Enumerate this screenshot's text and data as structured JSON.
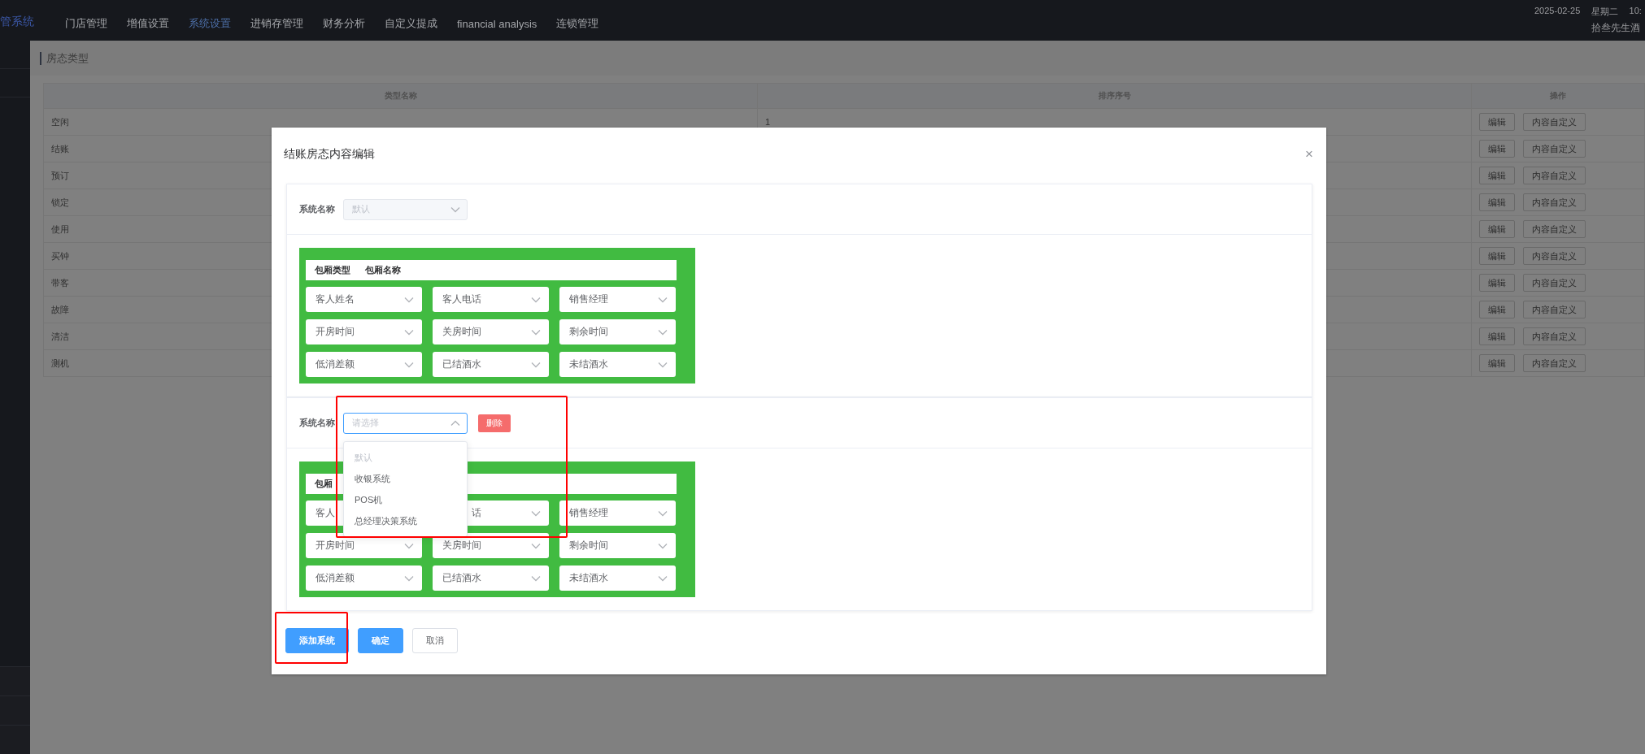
{
  "topbar": {
    "logo": "管系统",
    "nav": [
      {
        "label": "门店管理",
        "selected": false
      },
      {
        "label": "增值设置",
        "selected": false
      },
      {
        "label": "系统设置",
        "selected": true
      },
      {
        "label": "进销存管理",
        "selected": false
      },
      {
        "label": "财务分析",
        "selected": false
      },
      {
        "label": "自定义提成",
        "selected": false
      },
      {
        "label": "financial analysis",
        "selected": false
      },
      {
        "label": "连锁管理",
        "selected": false
      }
    ],
    "date": "2025-02-25",
    "weekday": "星期二",
    "time": "10:",
    "user": "拾叁先生酒"
  },
  "page": {
    "title": "房态类型"
  },
  "table": {
    "columns": [
      "类型名称",
      "排序序号",
      "操作"
    ],
    "rows": [
      {
        "name": "空闲",
        "sort": "1",
        "actions": [
          "编辑",
          "内容自定义"
        ]
      },
      {
        "name": "结账",
        "actions": [
          "编辑",
          "内容自定义"
        ]
      },
      {
        "name": "预订",
        "actions": [
          "编辑",
          "内容自定义"
        ]
      },
      {
        "name": "锁定",
        "actions": [
          "编辑",
          "内容自定义"
        ]
      },
      {
        "name": "使用",
        "actions": [
          "编辑",
          "内容自定义"
        ]
      },
      {
        "name": "买钟",
        "actions": [
          "编辑",
          "内容自定义"
        ]
      },
      {
        "name": "带客",
        "actions": [
          "编辑",
          "内容自定义"
        ]
      },
      {
        "name": "故障",
        "actions": [
          "编辑",
          "内容自定义"
        ]
      },
      {
        "name": "清洁",
        "actions": [
          "编辑",
          "内容自定义"
        ]
      },
      {
        "name": "测机",
        "actions": [
          "编辑",
          "内容自定义"
        ]
      }
    ]
  },
  "modal": {
    "title": "结账房态内容编辑",
    "close": "×",
    "sections": [
      {
        "label": "系统名称",
        "select": {
          "value": "默认",
          "disabled": true,
          "open": false
        },
        "header": [
          "包厢类型",
          "包厢名称"
        ],
        "fields": [
          {
            "kind": "select",
            "label": "客人姓名"
          },
          {
            "kind": "select",
            "label": "客人电话"
          },
          {
            "kind": "select",
            "label": "销售经理"
          },
          {
            "kind": "select",
            "label": "开房时间"
          },
          {
            "kind": "select",
            "label": "关房时间"
          },
          {
            "kind": "select",
            "label": "剩余时间"
          },
          {
            "kind": "select",
            "label": "低消差额"
          },
          {
            "kind": "select",
            "label": "已结酒水"
          },
          {
            "kind": "select",
            "label": "未结酒水"
          }
        ]
      },
      {
        "label": "系统名称",
        "select": {
          "placeholder": "请选择",
          "disabled": false,
          "open": true,
          "options": [
            {
              "label": "默认",
              "disabled": true
            },
            {
              "label": "收银系统",
              "disabled": false
            },
            {
              "label": "POS机",
              "disabled": false
            },
            {
              "label": "总经理决策系统",
              "disabled": false
            }
          ]
        },
        "delete": "删除",
        "header": [
          "包厢"
        ],
        "fields": [
          {
            "kind": "covered",
            "label": "客人"
          },
          {
            "kind": "clipped",
            "label": "话"
          },
          {
            "kind": "select",
            "label": "销售经理"
          },
          {
            "kind": "select",
            "label": "开房时间"
          },
          {
            "kind": "select",
            "label": "关房时间"
          },
          {
            "kind": "select",
            "label": "剩余时间"
          },
          {
            "kind": "select",
            "label": "低消差额"
          },
          {
            "kind": "select",
            "label": "已结酒水"
          },
          {
            "kind": "select",
            "label": "未结酒水"
          }
        ]
      }
    ],
    "buttons": [
      {
        "kind": "primary",
        "label": "添加系统"
      },
      {
        "kind": "primary",
        "label": "确定"
      },
      {
        "kind": "plain",
        "label": "取消"
      }
    ]
  },
  "annotations": [
    {
      "kind": "rect",
      "color": "#ff0000"
    },
    {
      "kind": "rect",
      "color": "#ff0000"
    }
  ]
}
